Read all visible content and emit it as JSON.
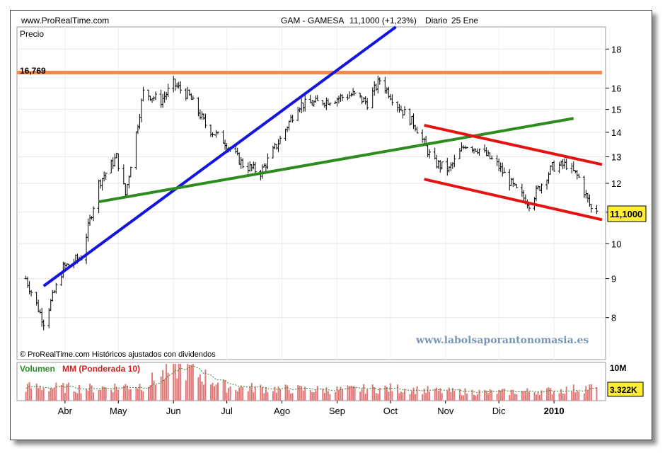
{
  "header": {
    "site": "www.ProRealTime.com",
    "instrument": "GAM - GAMESA",
    "quote": "11,1000 (+1,23%)",
    "period": "Diario",
    "date": "25 Ene"
  },
  "price_panel": {
    "label": "Precio",
    "resistance_label": "16,769",
    "last_price": "11,1000",
    "footer": "© ProRealTime.com Históricos ajustados con dividendos",
    "watermark": "www.labolsaporantonomasia.es"
  },
  "volume_panel": {
    "label_vol": "Volumen",
    "label_mm": "MM (Ponderada 10)",
    "axis_top": "10M",
    "last_volume": "3.322K"
  },
  "colors": {
    "resistance": "#f08a50",
    "uptrend": "#1414e0",
    "support": "#2e8b1e",
    "channel": "#e51212",
    "volume_bar": "#e07878",
    "volume_ma": "#2a8a2a",
    "label_box": "#ffee33"
  },
  "chart_data": [
    {
      "type": "line",
      "subtype": "ohlc-bars",
      "title": "GAM - GAMESA",
      "period": "Diario",
      "ylabel": "Precio",
      "scale": "log",
      "ylim": [
        7.2,
        19.0
      ],
      "y_ticks": [
        8,
        9,
        10,
        11,
        12,
        13,
        14,
        15,
        16,
        18
      ],
      "y_tick_labels": [
        "8",
        "9",
        "10",
        "11",
        "12",
        "13",
        "14",
        "15",
        "16",
        "18"
      ],
      "x_labels": [
        "Abr",
        "May",
        "Jun",
        "Jul",
        "Ago",
        "Sep",
        "Oct",
        "Nov",
        "Dic",
        "2010"
      ],
      "series": [
        {
          "x": [
            "2009-03-10",
            "2009-03-20",
            "2009-03-31",
            "2009-04-10",
            "2009-04-20",
            "2009-04-30",
            "2009-05-05",
            "2009-05-15",
            "2009-05-25",
            "2009-06-01",
            "2009-06-10",
            "2009-06-20",
            "2009-06-30",
            "2009-07-10",
            "2009-07-20",
            "2009-07-31",
            "2009-08-10",
            "2009-08-20",
            "2009-08-31",
            "2009-09-10",
            "2009-09-18",
            "2009-09-25",
            "2009-10-05",
            "2009-10-15",
            "2009-10-25",
            "2009-11-03",
            "2009-11-12",
            "2009-11-20",
            "2009-11-30",
            "2009-12-10",
            "2009-12-18",
            "2009-12-31",
            "2010-01-08",
            "2010-01-15",
            "2010-01-22",
            "2010-01-25"
          ],
          "values": [
            9.0,
            7.9,
            9.3,
            9.6,
            12.0,
            13.0,
            11.6,
            15.8,
            15.4,
            16.2,
            15.6,
            14.2,
            13.6,
            12.7,
            12.4,
            13.7,
            15.2,
            15.3,
            15.5,
            15.7,
            15.3,
            16.4,
            15.2,
            14.3,
            12.8,
            12.5,
            13.5,
            13.3,
            12.7,
            11.8,
            11.3,
            12.6,
            12.7,
            12.2,
            11.1,
            11.1
          ]
        }
      ],
      "lines": [
        {
          "name": "16,769",
          "kind": "resistance",
          "x": [
            "2009-03-05",
            "2010-01-28"
          ],
          "y": [
            16.769,
            16.769
          ]
        },
        {
          "kind": "uptrend",
          "x": [
            "2009-03-20",
            "2009-10-10"
          ],
          "y": [
            8.8,
            19.7
          ]
        },
        {
          "kind": "support",
          "x": [
            "2009-04-20",
            "2010-01-12"
          ],
          "y": [
            11.35,
            14.6
          ]
        },
        {
          "kind": "channel-upper",
          "x": [
            "2009-10-20",
            "2010-01-28"
          ],
          "y": [
            14.3,
            12.7
          ]
        },
        {
          "kind": "channel-lower",
          "x": [
            "2009-10-20",
            "2010-01-28"
          ],
          "y": [
            12.15,
            10.75
          ]
        }
      ]
    },
    {
      "type": "bar",
      "ylabel": "Volumen",
      "ylim": [
        0,
        10000000
      ],
      "y_tick_labels": [
        "10M"
      ],
      "last": "3.322K",
      "series": [
        {
          "x": [
            "2009-03-15",
            "2009-04-15",
            "2009-05-15",
            "2009-06-05",
            "2009-07-01",
            "2009-08-01",
            "2009-09-01",
            "2009-10-01",
            "2009-11-01",
            "2009-12-01",
            "2010-01-01",
            "2010-01-20"
          ],
          "values": [
            3500000,
            3200000,
            4000000,
            9000000,
            3600000,
            3000000,
            2800000,
            3200000,
            2400000,
            2200000,
            2600000,
            3322000
          ]
        }
      ]
    }
  ]
}
